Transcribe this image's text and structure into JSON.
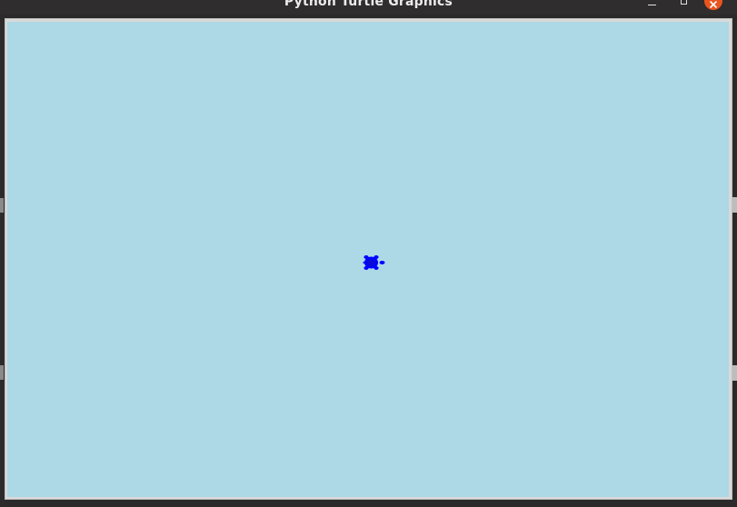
{
  "window": {
    "title": "Python Turtle Graphics"
  },
  "controls": {
    "minimize_icon": "minimize-icon",
    "maximize_icon": "maximize-icon",
    "close_icon": "close-icon"
  },
  "canvas": {
    "background_color": "#add8e6"
  },
  "turtle": {
    "shape": "turtle",
    "color": "#0000ff",
    "heading": "east"
  },
  "colors": {
    "titlebar": "#2f2d2d",
    "title_text": "#ececec",
    "close_button": "#e9541f",
    "frame": "#d9d9d9"
  }
}
